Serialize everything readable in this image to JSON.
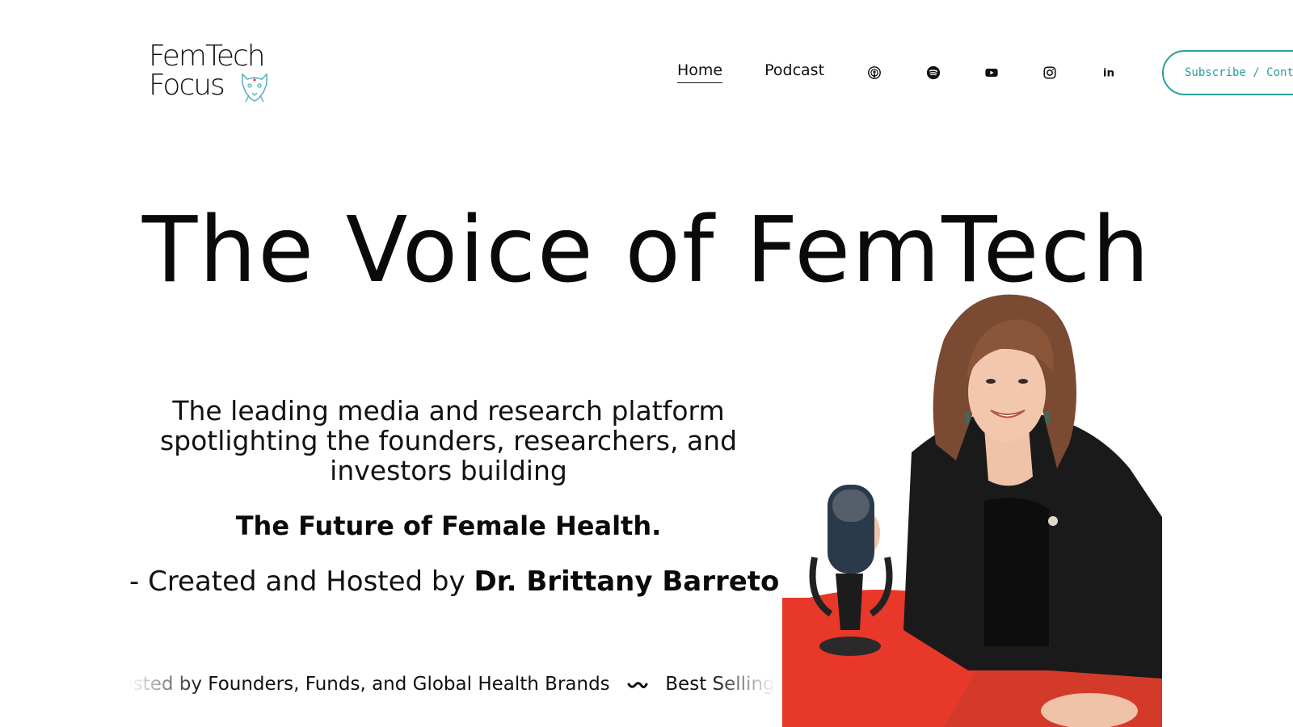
{
  "header": {
    "logo_line1": "FemTech",
    "logo_line2": "Focus",
    "nav": [
      {
        "label": "Home",
        "active": true
      },
      {
        "label": "Podcast",
        "active": false
      }
    ],
    "social_icons": [
      "apple-podcasts-icon",
      "spotify-icon",
      "youtube-icon",
      "instagram-icon",
      "linkedin-icon"
    ],
    "social_labels": {
      "linkedin": "in"
    },
    "subscribe_label": "Subscribe / Contact"
  },
  "hero": {
    "title": "The Voice of FemTech",
    "tagline": "The leading media and research platform spotlighting the founders, researchers, and investors building",
    "future": "The Future of Female Health.",
    "created_prefix": "- Created and Hosted by ",
    "host_name": "Dr. Brittany Barreto"
  },
  "marquee": {
    "item1": "Trusted by Founders, Funds, and Global Health Brands",
    "item2": "Best Selling Author"
  },
  "colors": {
    "accent": "#2a9d9d",
    "text": "#111111",
    "table_red": "#e8382a"
  }
}
